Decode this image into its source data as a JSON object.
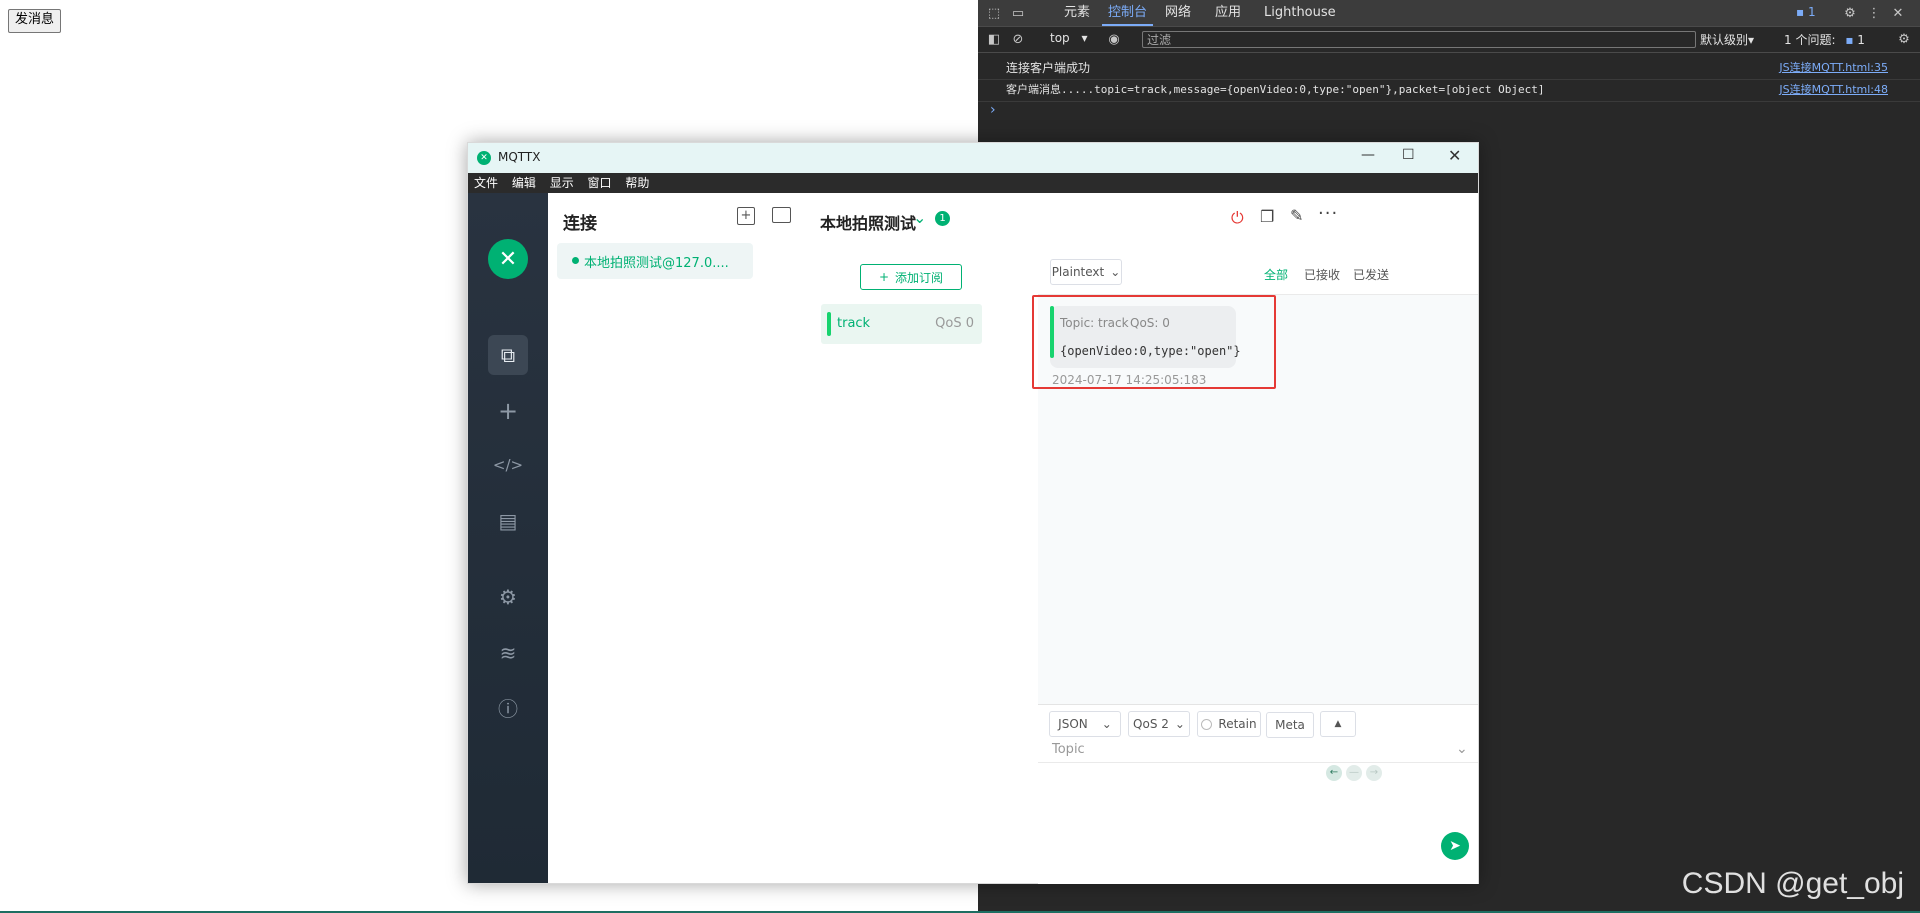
{
  "page": {
    "send_button": "发消息",
    "watermark": "CSDN @get_obj"
  },
  "devtools": {
    "tabs": [
      "元素",
      "控制台",
      "网络",
      "应用",
      "Lighthouse"
    ],
    "active_tab": "控制台",
    "issues_badge": "1",
    "context": "top",
    "filter_placeholder": "过滤",
    "level": "默认级别",
    "issues_label": "1 个问题:",
    "issues_count": "1",
    "logs": [
      {
        "message": "连接客户端成功",
        "source": "JS连接MQTT.html:35"
      },
      {
        "message": "客户端消息.....topic=track,message={openVideo:0,type:\"open\"},packet=[object Object]",
        "source": "JS连接MQTT.html:48"
      }
    ],
    "prompt": "›"
  },
  "mqttx": {
    "title": "MQTTX",
    "menu": [
      "文件",
      "编辑",
      "显示",
      "窗口",
      "帮助"
    ],
    "connections_title": "连接",
    "connection_item": "本地拍照测试@127.0....",
    "active_connection": "本地拍照测试",
    "connection_badge": "1",
    "add_subscription": "添加订阅",
    "subscription": {
      "topic": "track",
      "qos": "QoS 0"
    },
    "payload_format": "Plaintext",
    "filters": [
      "全部",
      "已接收",
      "已发送"
    ],
    "message": {
      "topic_label": "Topic: track",
      "qos_label": "QoS: 0",
      "payload": "{openVideo:0,type:\"open\"}",
      "time": "2024-07-17 14:25:05:183"
    },
    "publish": {
      "format": "JSON",
      "qos": "QoS 2",
      "retain": "Retain",
      "meta": "Meta",
      "topic_placeholder": "Topic"
    },
    "colors": {
      "accent": "#00b173",
      "highlight": "#e53935"
    }
  }
}
